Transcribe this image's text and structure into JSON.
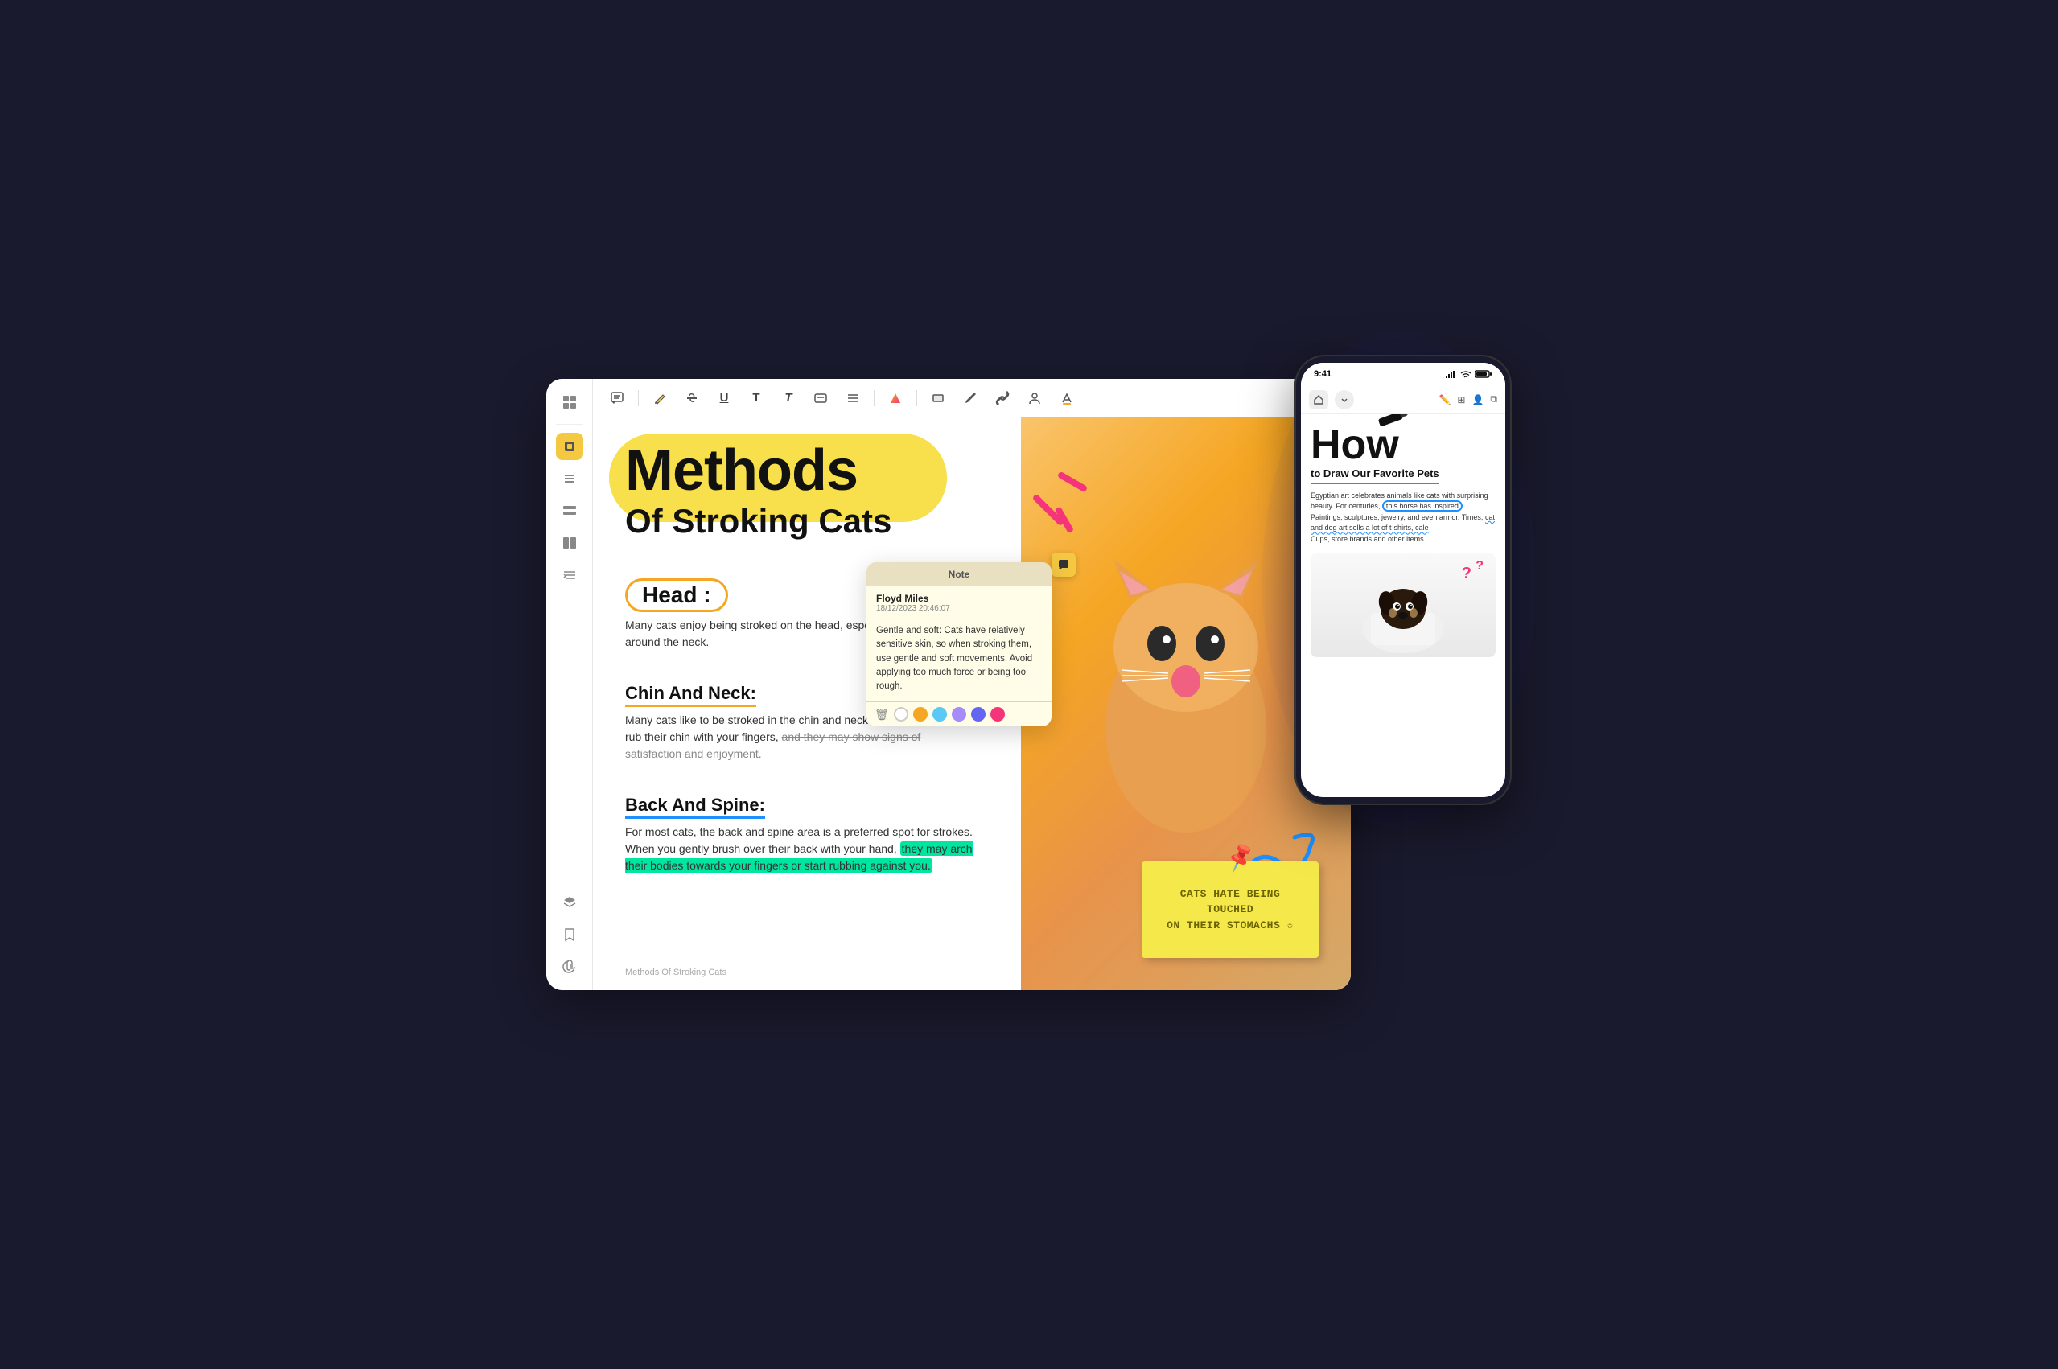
{
  "app": {
    "title": "Methods Of Stroking Cats"
  },
  "toolbar": {
    "icons": [
      "comment",
      "highlight",
      "strikethrough",
      "underline",
      "text",
      "bold-text",
      "text-box",
      "list",
      "gradient-text",
      "shape-fill",
      "rectangle",
      "pen",
      "link",
      "person",
      "font-color"
    ]
  },
  "sidebar": {
    "icons": [
      "grid",
      "divider",
      "highlight-tool",
      "list-view",
      "grid-view",
      "text-columns",
      "indent",
      "layers",
      "bookmark",
      "attachment"
    ]
  },
  "document": {
    "title_line1": "Methods",
    "title_line2": "Of Stroking Cats",
    "section1_label": "Head :",
    "section1_body": "Many cats enjoy being stroked on the head, especially under the chin, and around the neck.",
    "section2_title": "Chin And Neck:",
    "section2_body1": "Many cats like to be stroked in the chin and neck area,",
    "section2_body2": "rub their chin with your fingers,",
    "section2_strikethrough": "and they may show signs of",
    "section2_body3": "satisfaction and enjoyment.",
    "section3_title": "Back And Spine:",
    "section3_body1": "For most cats, the back and spine area is a preferred spot for strokes. When you gently brush over their back with your hand,",
    "section3_highlight": "they may arch their bodies towards your fingers or start rubbing against you.",
    "footer": "Methods Of Stroking Cats"
  },
  "note": {
    "header": "Note",
    "author": "Floyd Miles",
    "date": "18/12/2023 20:46:07",
    "body": "Gentle and soft: Cats have relatively sensitive skin, so when stroking them, use gentle and soft movements. Avoid applying too much force or being too rough.",
    "colors": [
      "#fff",
      "#f5a623",
      "#5bc8f5",
      "#a78bfa",
      "#6366f1",
      "#f4357a"
    ]
  },
  "sticky_note": {
    "text": "CATS HATE BEING TOUCHED\nON THEIR STOMACHS ✩"
  },
  "phone": {
    "time": "9:41",
    "signal": "●●●",
    "wifi": "wifi",
    "battery": "battery",
    "title_how": "How",
    "title_sub": "to Draw Our Favorite Pets",
    "body1": "Egyptian art celebrates animals like cats with surprising beauty. For centuries,",
    "highlighted_text": "this horse has inspired",
    "body2": "Paintings, sculptures, jewelry, and even armor. Times,",
    "wavy_text": "cat and dog art sells a lot of t-shirts, cale",
    "body3": "Cups, store brands and other items."
  }
}
